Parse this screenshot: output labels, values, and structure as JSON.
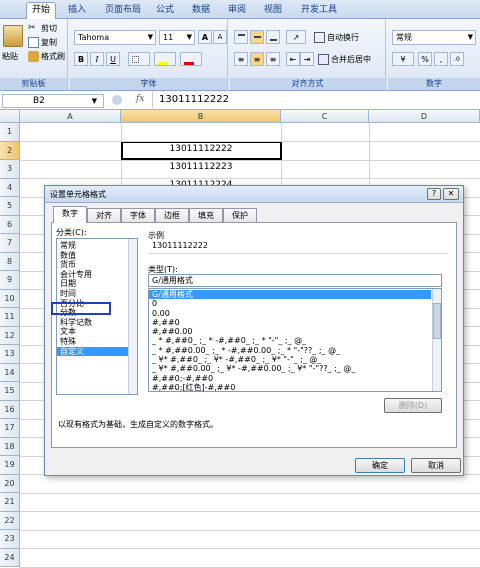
{
  "ribbon_tabs": [
    "开始",
    "插入",
    "页面布局",
    "公式",
    "数据",
    "审阅",
    "视图",
    "开发工具"
  ],
  "clipboard": {
    "paste": "粘贴",
    "cut": "剪切",
    "copy": "复制",
    "format_painter": "格式刷",
    "label": "剪贴板"
  },
  "font": {
    "name": "Tahoma",
    "size": "11",
    "label": "字体",
    "bold": "B",
    "italic": "I",
    "underline": "U",
    "grow": "A",
    "shrink": "A"
  },
  "alignment": {
    "wrap": "自动换行",
    "merge": "合并后居中",
    "label": "对齐方式"
  },
  "number": {
    "format": "常规",
    "pct": "%",
    "comma": ",",
    "label": "数字"
  },
  "formula_bar": {
    "name_box": "B2",
    "fx": "fx",
    "value": "13011112222"
  },
  "sheet": {
    "columns": [
      "A",
      "B",
      "C",
      "D"
    ],
    "rows": [
      "1",
      "2",
      "3",
      "4",
      "5",
      "6",
      "7",
      "8",
      "9",
      "10",
      "11",
      "12",
      "13",
      "14",
      "15",
      "16",
      "17",
      "18",
      "19",
      "20",
      "21",
      "22",
      "23",
      "24"
    ],
    "cells": {
      "b2": "13011112222",
      "b3": "13011112223",
      "b4": "13011112224"
    }
  },
  "dialog": {
    "title": "设置单元格格式",
    "help": "?",
    "close": "✕",
    "tabs": [
      "数字",
      "对齐",
      "字体",
      "边框",
      "填充",
      "保护"
    ],
    "category_label": "分类(C):",
    "categories": [
      "常规",
      "数值",
      "货币",
      "会计专用",
      "日期",
      "时间",
      "百分比",
      "分数",
      "科学记数",
      "文本",
      "特殊",
      "自定义"
    ],
    "sample_label": "示例",
    "sample_value": "13011112222",
    "type_label": "类型(T):",
    "type_value": "G/通用格式",
    "types": [
      "G/通用格式",
      "0",
      "0.00",
      "#,##0",
      "#,##0.00",
      "_ * #,##0_ ;_ * -#,##0_ ;_ * \"-\"_ ;_ @_",
      "_ * #,##0.00_ ;_ * -#,##0.00_ ;_ * \"-\"??_ ;_ @_",
      "_ ¥* #,##0_ ;_ ¥* -#,##0_ ;_ ¥* \"-\"_ ;_ @_",
      "_ ¥* #,##0.00_ ;_ ¥* -#,##0.00_ ;_ ¥* \"-\"??_ ;_ @_",
      "#,##0;-#,##0",
      "#,##0;[红色]-#,##0"
    ],
    "delete_button": "删除(D)",
    "description": "以现有格式为基础，生成自定义的数字格式。",
    "ok": "确定",
    "cancel": "取消"
  },
  "colors": {
    "accent": "#3399ff",
    "highlight_box": "#1f3fbf",
    "ribbon": "#dbe6f4"
  }
}
